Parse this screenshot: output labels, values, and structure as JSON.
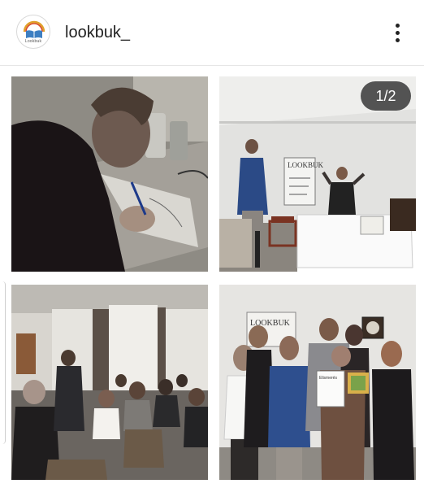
{
  "header": {
    "username": "lookbuk_",
    "avatar_text": "Lookbuk",
    "more_icon": "more-vertical-icon"
  },
  "grid": {
    "tiles": [
      {
        "name": "photo-woman-writing"
      },
      {
        "name": "photo-presentation-room",
        "badge": "1/2"
      },
      {
        "name": "photo-audience"
      },
      {
        "name": "photo-group-certificate"
      }
    ]
  },
  "photo_board": {
    "board_text": "LOOKBUK",
    "wall_sign": "LOOKBUK",
    "certificate": "Elismerés"
  }
}
